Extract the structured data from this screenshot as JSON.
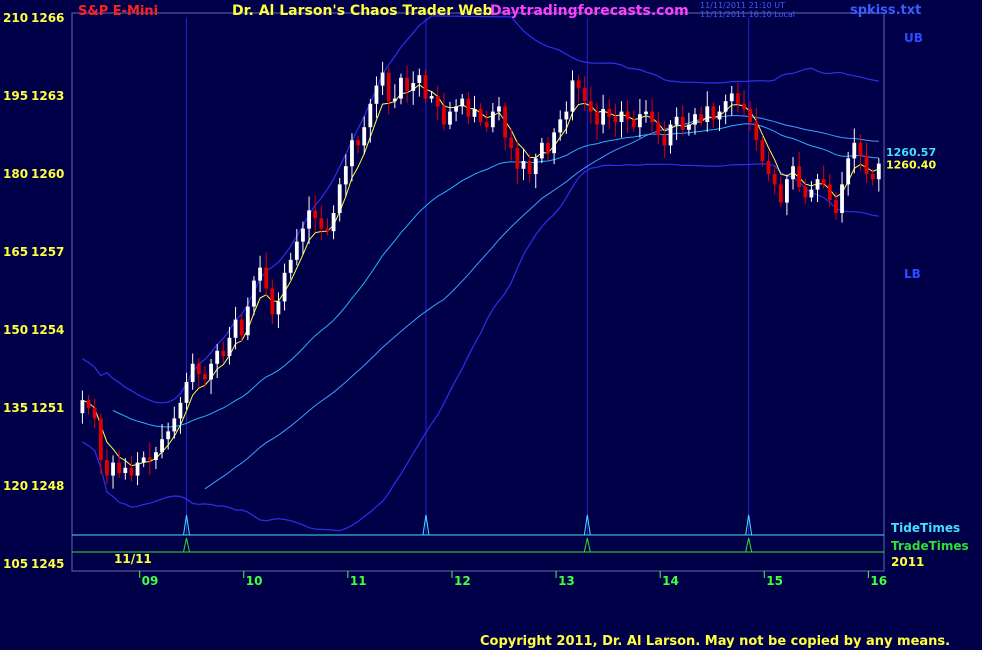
{
  "header": {
    "symbol": "S&P E-Mini",
    "title": "Dr. Al Larson's Chaos Trader Web",
    "site": "Daytradingforecasts.com",
    "timestamp_ut": "11/11/2011 21:10 UT",
    "timestamp_local": "11/11/2011 16:10 Local",
    "file": "spkiss.txt"
  },
  "footer": {
    "copyright": "Copyright 2011, Dr. Al Larson. May not be copied by any means."
  },
  "colors": {
    "background": "#000048",
    "up_candle": "#ffffff",
    "down_candle": "#e00000",
    "bands": "#2e2ef0",
    "ma_slow": "#20b4ff",
    "ma_mid": "#3aa0ff",
    "ma_fast": "#ffff40",
    "tide": "#40e0ff",
    "trade": "#30e030",
    "y_labels": "#ffff40",
    "x_labels": "#40ff40",
    "symbol": "#ff2020",
    "site": "#ff40ff"
  },
  "chart_data": {
    "type": "candlestick",
    "y_ticks": [
      {
        "left": "105",
        "price": "1245",
        "value": 1245
      },
      {
        "left": "120",
        "price": "1248",
        "value": 1248
      },
      {
        "left": "135",
        "price": "1251",
        "value": 1251
      },
      {
        "left": "150",
        "price": "1254",
        "value": 1254
      },
      {
        "left": "165",
        "price": "1257",
        "value": 1257
      },
      {
        "left": "180",
        "price": "1260",
        "value": 1260
      },
      {
        "left": "195",
        "price": "1263",
        "value": 1263
      },
      {
        "left": "210",
        "price": "1266",
        "value": 1266
      }
    ],
    "ylim": [
      1245,
      1266
    ],
    "x_range": [
      8.35,
      16.15
    ],
    "x_ticks": [
      {
        "label": "09",
        "x": 9
      },
      {
        "label": "10",
        "x": 10
      },
      {
        "label": "11",
        "x": 11
      },
      {
        "label": "12",
        "x": 12
      },
      {
        "label": "13",
        "x": 13
      },
      {
        "label": "14",
        "x": 14
      },
      {
        "label": "15",
        "x": 15
      },
      {
        "label": "16",
        "x": 16
      }
    ],
    "date_label": "11/11",
    "year_label": "2011",
    "price_labels": [
      {
        "text": "1260.57",
        "value": 1260.57,
        "color": "#40e0ff"
      },
      {
        "text": "1260.40",
        "value": 1260.4,
        "color": "#ffff40"
      }
    ],
    "band_labels": {
      "upper": "UB",
      "lower": "LB"
    },
    "legend": {
      "tide": "TideTimes",
      "trade": "TradeTimes"
    },
    "tide_times": [
      9.45,
      11.75,
      13.3,
      14.85
    ],
    "trade_times": [
      9.45,
      13.3,
      14.85
    ],
    "closes": [
      1251.3,
      1251.0,
      1250.6,
      1249.0,
      1248.4,
      1248.9,
      1248.5,
      1248.7,
      1248.4,
      1248.9,
      1249.1,
      1249.0,
      1249.3,
      1249.8,
      1250.1,
      1250.6,
      1251.2,
      1252.0,
      1252.7,
      1252.3,
      1252.1,
      1252.7,
      1253.2,
      1253.0,
      1253.7,
      1254.4,
      1253.8,
      1254.9,
      1255.9,
      1256.4,
      1255.6,
      1254.6,
      1255.1,
      1256.2,
      1256.7,
      1257.4,
      1257.9,
      1258.6,
      1258.3,
      1257.9,
      1257.8,
      1258.5,
      1259.6,
      1260.3,
      1261.3,
      1261.1,
      1261.8,
      1262.7,
      1263.4,
      1263.9,
      1262.8,
      1262.9,
      1263.7,
      1263.2,
      1263.5,
      1263.8,
      1262.9,
      1263.0,
      1262.6,
      1261.9,
      1262.4,
      1262.6,
      1262.9,
      1262.2,
      1262.5,
      1262.0,
      1261.8,
      1262.4,
      1262.6,
      1261.4,
      1261.0,
      1260.2,
      1260.5,
      1260.0,
      1260.6,
      1261.2,
      1260.8,
      1261.6,
      1262.1,
      1262.4,
      1263.6,
      1263.3,
      1262.8,
      1262.4,
      1261.9,
      1262.5,
      1262.2,
      1262.0,
      1262.4,
      1262.1,
      1261.8,
      1262.3,
      1262.4,
      1262.0,
      1261.5,
      1261.1,
      1261.9,
      1262.2,
      1261.7,
      1261.9,
      1262.3,
      1262.0,
      1262.6,
      1262.1,
      1262.4,
      1262.8,
      1263.1,
      1262.7,
      1262.5,
      1262.0,
      1261.3,
      1260.5,
      1260.0,
      1259.6,
      1258.9,
      1259.8,
      1260.3,
      1259.5,
      1259.1,
      1259.4,
      1259.8,
      1259.6,
      1259.0,
      1258.5,
      1259.6,
      1260.6,
      1261.2,
      1260.7,
      1260.0,
      1259.8,
      1260.4
    ]
  }
}
